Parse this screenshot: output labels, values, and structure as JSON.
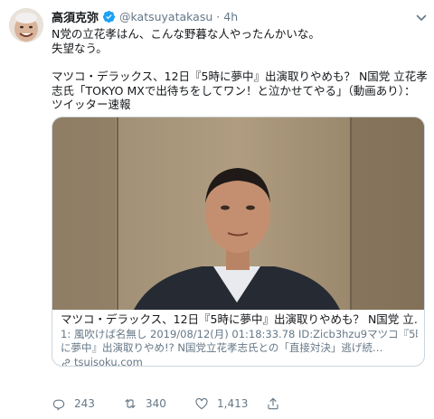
{
  "tweet": {
    "display_name": "高須克弥",
    "handle": "@katsuyatakasu",
    "separator": "·",
    "time": "4h",
    "text_lines": [
      "N党の立花孝はん、こんな野暮な人やったんかいな。",
      "失望なう。"
    ],
    "shared_lines": [
      "マツコ・デラックス、12日『5時に夢中』出演取りやめも？ N国党 立花孝",
      "志氏「TOKYO MXで出待ちをしてワン！と泣かせてやる」（動画あり）：",
      "ツイッター速報"
    ]
  },
  "card": {
    "title": "マツコ・デラックス、12日『5時に夢中』出演取りやめも？ N国党 立…",
    "description_lines": [
      "1: 風吹けば名無し 2019/08/12(月) 01:18:33.78 ID:Zicb3hzu9マツコ『5時",
      "に夢中』出演取りやめ!? N国党立花孝志氏との「直接対決」逃げ続…"
    ],
    "domain": "tsuisoku.com"
  },
  "actions": {
    "reply_count": "243",
    "retweet_count": "340",
    "like_count": "1,413"
  },
  "colors": {
    "verified": "#1da1f2",
    "secondary_text": "#657786",
    "card_border": "#ccd6dd"
  },
  "icons": {
    "verified": "verified-badge-icon",
    "caret": "chevron-down-icon",
    "link": "link-icon",
    "reply": "reply-icon",
    "retweet": "retweet-icon",
    "like": "heart-icon",
    "share": "share-icon"
  }
}
